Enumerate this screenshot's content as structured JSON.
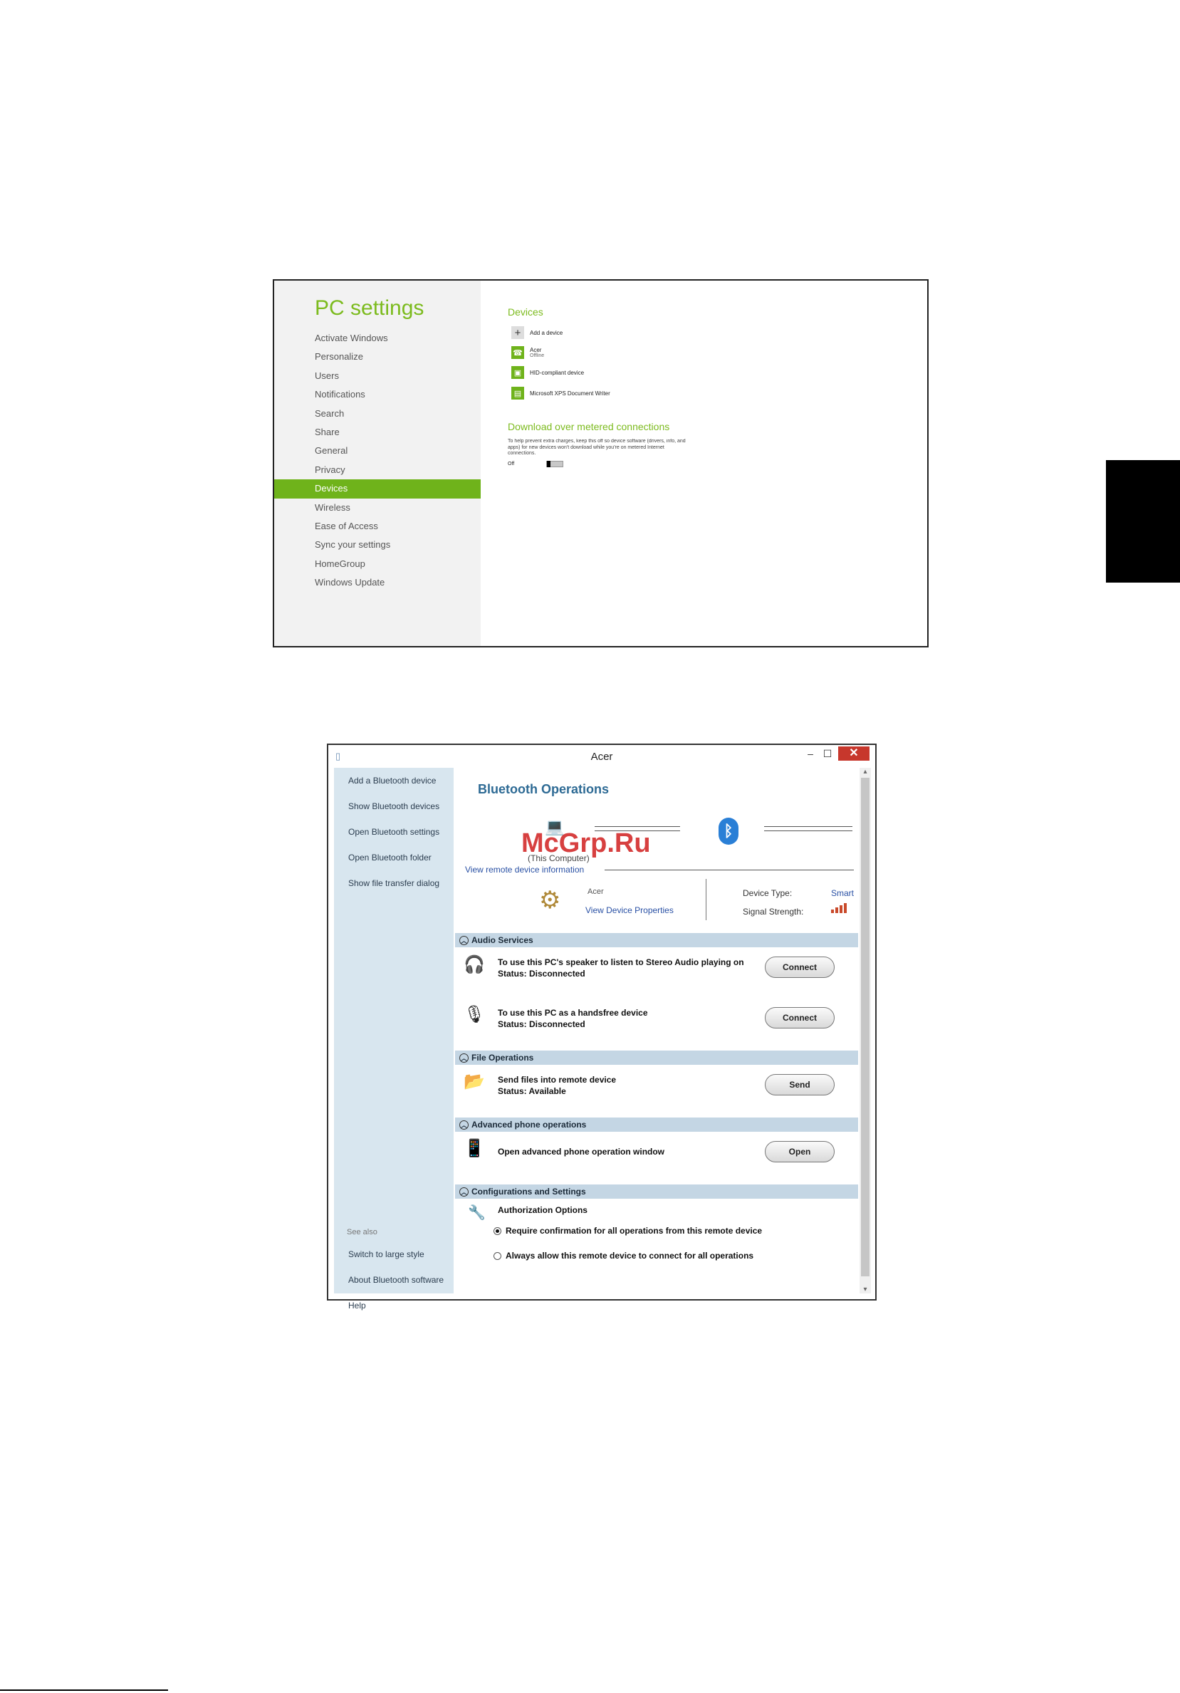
{
  "pc_settings": {
    "title": "PC settings",
    "nav_items": [
      "Activate Windows",
      "Personalize",
      "Users",
      "Notifications",
      "Search",
      "Share",
      "General",
      "Privacy",
      "Devices",
      "Wireless",
      "Ease of Access",
      "Sync your settings",
      "HomeGroup",
      "Windows Update"
    ],
    "active_item": "Devices",
    "devices_heading": "Devices",
    "add_device": "Add a device",
    "devices": [
      {
        "name": "Acer",
        "status": "Offline"
      },
      {
        "name": "HID-compliant device",
        "status": ""
      },
      {
        "name": "Microsoft XPS Document Writer",
        "status": ""
      }
    ],
    "metered_heading": "Download over metered connections",
    "metered_desc": "To help prevent extra charges, keep this off so device software (drivers, info, and apps) for new devices won't download while you're on metered Internet connections.",
    "toggle_label": "Off",
    "toggle_on": false
  },
  "bluetooth_window": {
    "title": "Acer",
    "close_symbol": "✕",
    "sidebar_links": [
      "Add a Bluetooth device",
      "Show Bluetooth devices",
      "Open Bluetooth settings",
      "Open Bluetooth folder",
      "Show file transfer dialog"
    ],
    "see_also_label": "See also",
    "see_also_links": [
      "Switch to large style",
      "About Bluetooth software",
      "Help"
    ],
    "heading": "Bluetooth Operations",
    "this_computer": "(This Computer)",
    "view_remote_link": "View remote device information",
    "device_name": "Acer",
    "view_properties_link": "View Device Properties",
    "device_type_label": "Device Type:",
    "device_type_value": "Smart",
    "signal_strength_label": "Signal Strength:",
    "sections": {
      "audio": "Audio Services",
      "file": "File Operations",
      "phone": "Advanced phone operations",
      "config": "Configurations and Settings"
    },
    "audio_stereo": {
      "title": "To use this PC's speaker to listen to Stereo Audio playing on",
      "status": "Status:   Disconnected",
      "button": "Connect"
    },
    "audio_handsfree": {
      "title": "To use this PC as a handsfree device",
      "status": "Status:   Disconnected",
      "button": "Connect"
    },
    "file_send": {
      "title": "Send files into remote device",
      "status": "Status:   Available",
      "button": "Send"
    },
    "phone_open": {
      "title": "Open advanced phone operation window",
      "button": "Open"
    },
    "auth": {
      "title": "Authorization Options",
      "option_confirm": "Require confirmation for all operations from this remote device",
      "option_allow": "Always allow this remote device to connect for all operations",
      "selected": "confirm"
    }
  },
  "watermark": "McGrp.Ru",
  "colors": {
    "win8_green": "#6fb31b",
    "bt_blue": "#2d6a94",
    "close_red": "#c7372c",
    "sidebar_bg": "#d8e6ef"
  }
}
